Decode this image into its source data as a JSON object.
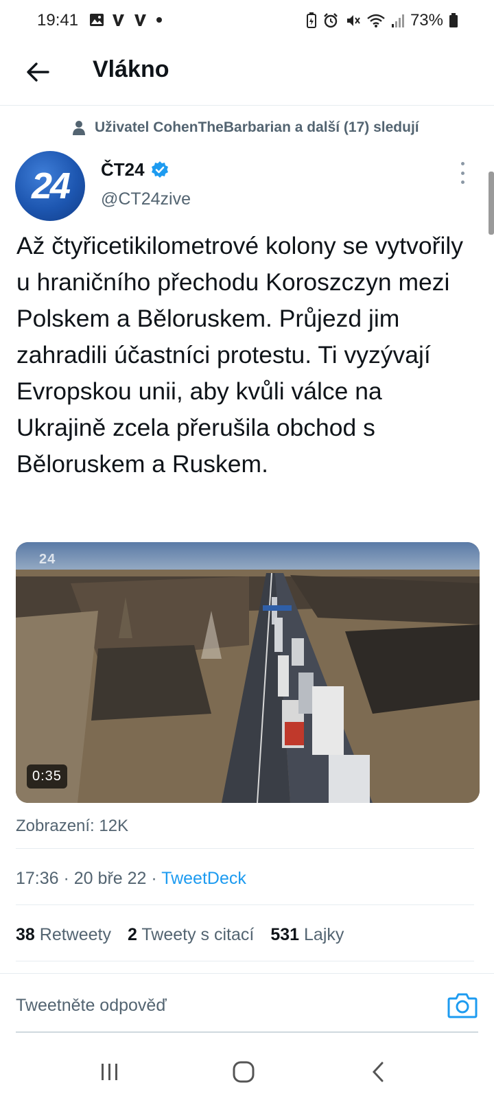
{
  "status_bar": {
    "time": "19:41",
    "battery": "73%",
    "left_icons": [
      "image-icon",
      "v-app-icon",
      "v-app-icon",
      "dot-icon"
    ],
    "right_icons": [
      "battery-saver-icon",
      "alarm-icon",
      "mute-icon",
      "wifi-icon",
      "signal-icon",
      "battery-icon"
    ]
  },
  "header": {
    "title": "Vlákno",
    "back_icon": "arrow-left-icon"
  },
  "social_context": {
    "text": "Uživatel CohenTheBarbarian a další (17) sledují",
    "icon": "person-icon"
  },
  "author": {
    "name": "ČT24",
    "handle": "@CT24zive",
    "avatar_text": "24",
    "verified": true
  },
  "tweet": {
    "text": "Až čtyřicetikilometrové kolony se vytvořily u hraničního přechodu Koroszczyn mezi Polskem a Běloruskem. Průjezd jim zahradili účastníci protestu. Ti vyzývají Evropskou unii, aby kvůli válce na Ukrajině zcela přerušila obchod s Běloruskem a Ruskem."
  },
  "media": {
    "type": "video",
    "watermark": "24",
    "duration": "0:35"
  },
  "views": "Zobrazení: 12K",
  "timestamp": {
    "time": "17:36",
    "sep1": " · ",
    "date": "20 bře 22",
    "sep2": " · ",
    "source": "TweetDeck"
  },
  "stats": {
    "retweets_count": "38",
    "retweets_label": "Retweety",
    "quotes_count": "2",
    "quotes_label": "Tweety s citací",
    "likes_count": "531",
    "likes_label": "Lajky"
  },
  "reply": {
    "placeholder": "Tweetněte odpověď"
  },
  "colors": {
    "accent": "#1d9bf0",
    "text_primary": "#0f1419",
    "text_secondary": "#536471",
    "divider": "#e6ecf0"
  }
}
